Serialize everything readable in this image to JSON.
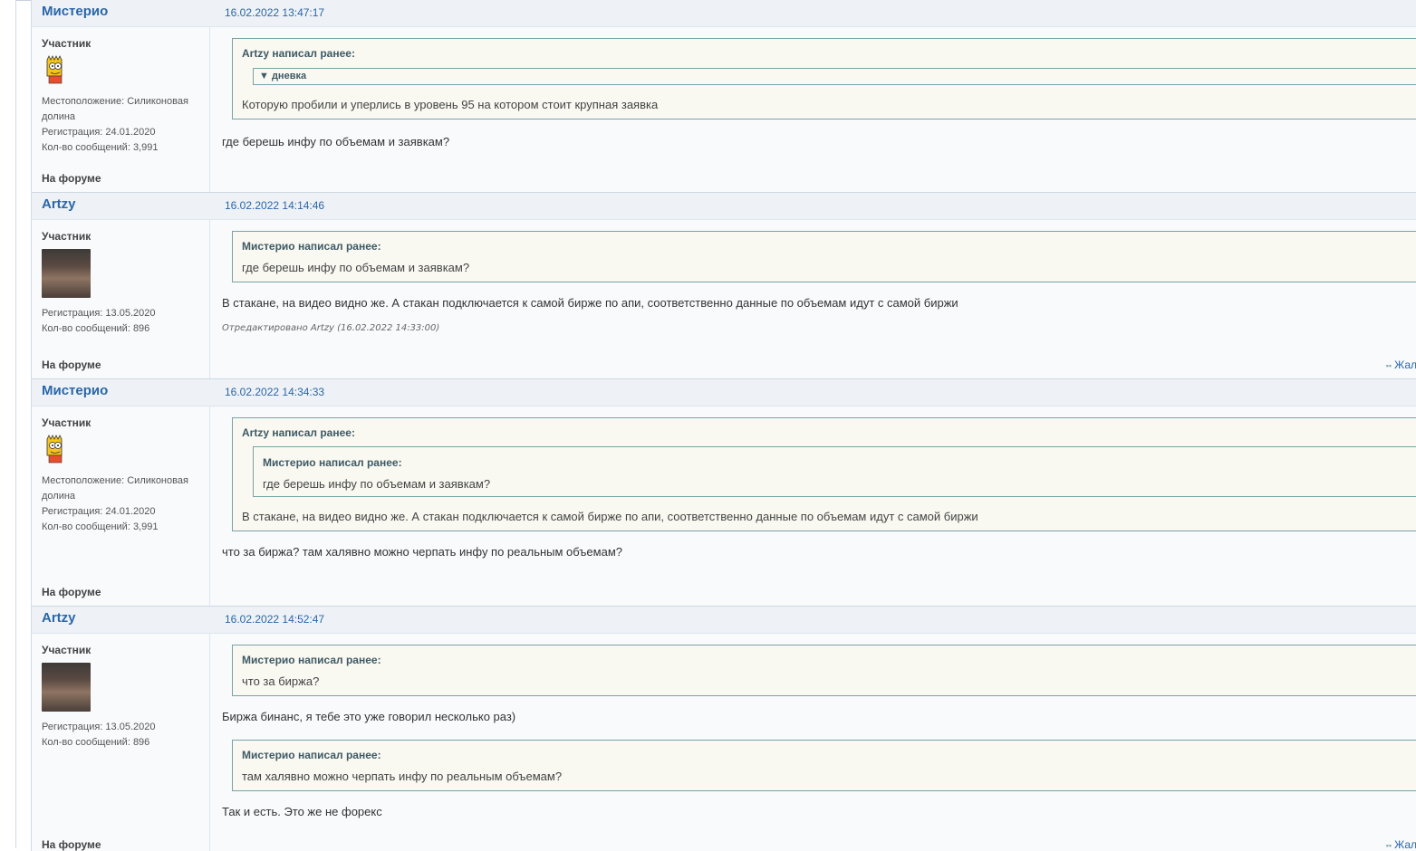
{
  "posts": [
    {
      "author": "Мистерио",
      "date": "16.02.2022 13:47:17",
      "role": "Участник",
      "avatar": "bart-avatar",
      "location": "Местоположение: Силиконовая долина",
      "registered": "Регистрация: 24.01.2020",
      "messages": "Кол-во сообщений: 3,991",
      "on_forum": "На форуме",
      "quote": {
        "title": "Artzy написал ранее:",
        "spoiler": "▼ дневка",
        "text": "Которую пробили и уперлись в уровень 95 на котором стоит крупная заявка"
      },
      "message": "где берешь инфу по объемам и заявкам?"
    },
    {
      "author": "Artzy",
      "date": "16.02.2022 14:14:46",
      "role": "Участник",
      "avatar": "portrait-avatar",
      "registered": "Регистрация: 13.05.2020",
      "messages": "Кол-во сообщений: 896",
      "on_forum": "На форуме",
      "quote": {
        "title": "Мистерио написал ранее:",
        "text": "где берешь инфу по объемам и заявкам?"
      },
      "message": "В стакане, на видео видно же. А стакан подключается к самой бирже по апи, соответственно данные по объемам идут с самой биржи",
      "edited": "Отредактировано Artzy (16.02.2022 14:33:00)",
      "report": "Жал"
    },
    {
      "author": "Мистерио",
      "date": "16.02.2022 14:34:33",
      "role": "Участник",
      "avatar": "bart-avatar",
      "location": "Местоположение: Силиконовая долина",
      "registered": "Регистрация: 24.01.2020",
      "messages": "Кол-во сообщений: 3,991",
      "on_forum": "На форуме",
      "quote": {
        "title": "Artzy написал ранее:",
        "inner_title": "Мистерио написал ранее:",
        "inner_text": "где берешь инфу по объемам и заявкам?",
        "text": "В стакане, на видео видно же. А стакан подключается к самой бирже по апи, соответственно данные по объемам идут с самой биржи"
      },
      "message": "что за биржа? там халявно можно черпать инфу по реальным объемам?"
    },
    {
      "author": "Artzy",
      "date": "16.02.2022 14:52:47",
      "role": "Участник",
      "avatar": "portrait-avatar",
      "registered": "Регистрация: 13.05.2020",
      "messages": "Кол-во сообщений: 896",
      "on_forum": "На форуме",
      "quote1": {
        "title": "Мистерио написал ранее:",
        "text": "что за биржа?"
      },
      "message1": "Биржа бинанс, я тебе это уже говорил несколько раз)",
      "quote2": {
        "title": "Мистерио написал ранее:",
        "text": "там халявно можно черпать инфу по реальным объемам?"
      },
      "message2": "Так и есть. Это же не форекс",
      "report": "Жал"
    }
  ]
}
